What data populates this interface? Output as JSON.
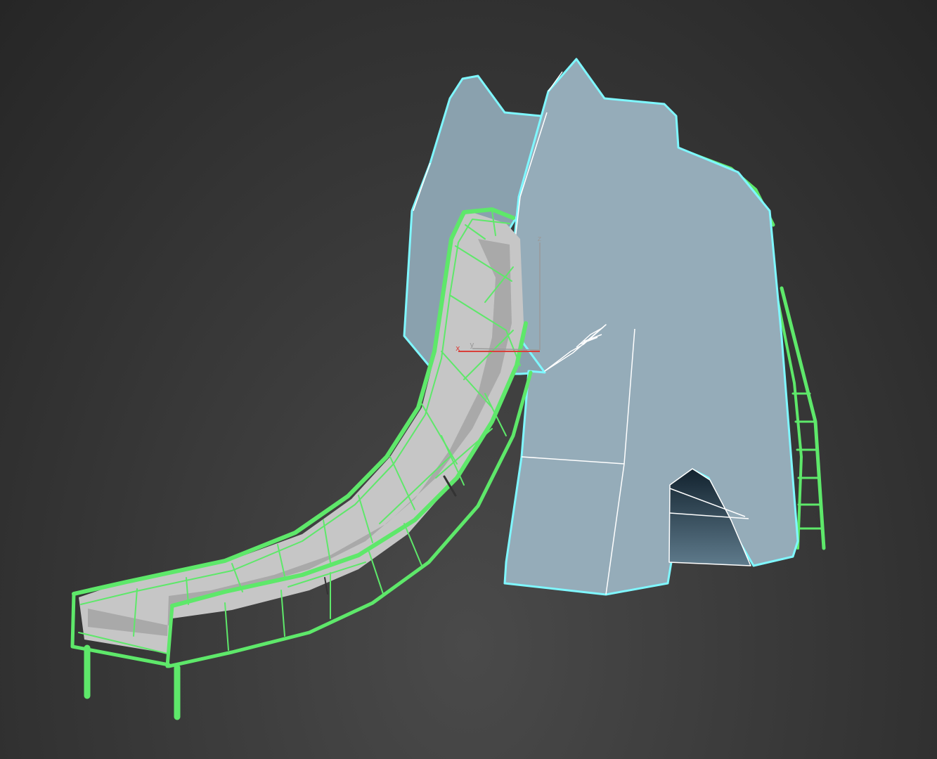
{
  "viewport": {
    "background_color": "#383838"
  },
  "colors": {
    "elephant_fill": "#95acb9",
    "elephant_shadow": "#8aa1ae",
    "elephant_edge_highlight": "#7ff7ff",
    "elephant_inner_wire": "#ffffff",
    "slide_wire": "#5ee86a",
    "slide_fill": "#c6c6c6",
    "slide_fill_dark": "#a9a9a9",
    "opening_top": "#12222e",
    "opening_bottom": "#5f7b8c"
  },
  "gizmo": {
    "x_label": "x",
    "y_label": "y",
    "z_label": "z",
    "x_color": "#d9403a",
    "y_color": "#9a9a9a",
    "z_color": "#9a9a9a"
  },
  "objects": [
    {
      "name": "elephant-body",
      "selected": true
    },
    {
      "name": "slide-chute",
      "selected": true
    },
    {
      "name": "ladder",
      "selected": true
    }
  ]
}
